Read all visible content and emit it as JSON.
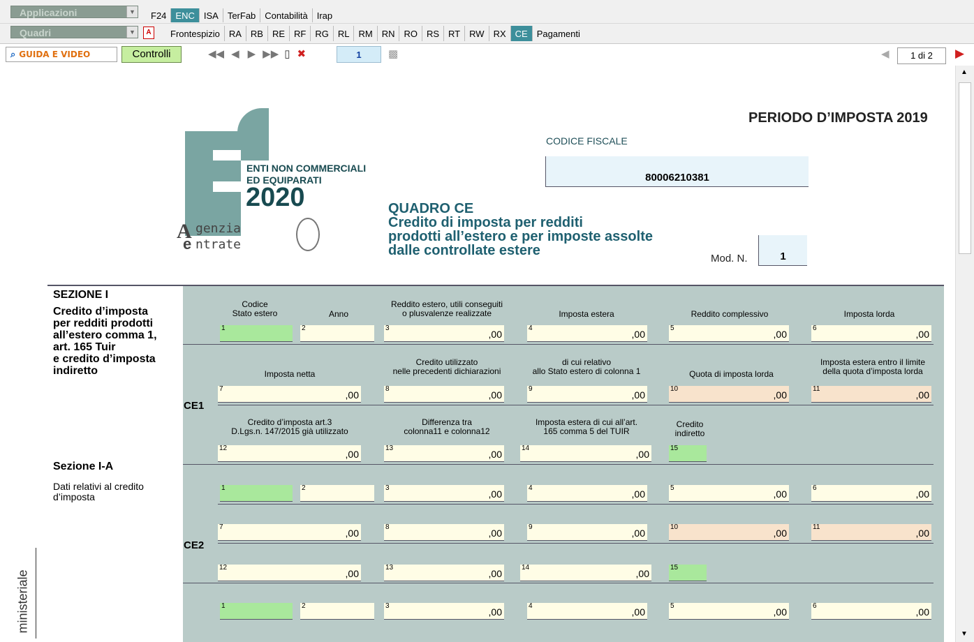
{
  "toolbar1": {
    "combo": "Applicazioni",
    "tabs": [
      "F24",
      "ENC",
      "ISA",
      "TerFab",
      "Contabilità",
      "Irap"
    ],
    "active": "ENC"
  },
  "toolbar2": {
    "combo": "Quadri",
    "tabs": [
      "Frontespizio",
      "RA",
      "RB",
      "RE",
      "RF",
      "RG",
      "RL",
      "RM",
      "RN",
      "RO",
      "RS",
      "RT",
      "RW",
      "RX",
      "CE",
      "Pagamenti"
    ],
    "active": "CE"
  },
  "toolbar3": {
    "guide": "GUIDA E VIDEO",
    "controlli": "Controlli",
    "page": "1",
    "pageinfo": "1 di 2"
  },
  "header": {
    "periodo": "PERIODO D’IMPOSTA 2019",
    "cf_label": "CODICE FISCALE",
    "cf_value": "80006210381",
    "logo_l1": "ENTI NON COMMERCIALI",
    "logo_l2": "ED EQUIPARATI",
    "logo_year": "2020",
    "agenzia_1": "genzia",
    "agenzia_2": "ntrate",
    "quadro": "QUADRO CE",
    "titolo_1": "Credito di imposta per redditi",
    "titolo_2": "prodotti all’estero e per imposte assolte",
    "titolo_3": "dalle controllate estere",
    "mod_label": "Mod. N.",
    "mod_value": "1"
  },
  "left": {
    "sez": "SEZIONE I",
    "desc_1": "Credito d’imposta",
    "desc_2": "per redditi prodotti",
    "desc_3": "all’estero comma 1,",
    "desc_4": "art. 165 Tuir",
    "desc_5": "e credito d’imposta",
    "desc_6": "indiretto",
    "sezA": "Sezione I-A",
    "sezA_d1": "Dati relativi al credito",
    "sezA_d2": "d’imposta",
    "side": "ministeriale"
  },
  "rows": {
    "ce1": "CE1",
    "ce2": "CE2"
  },
  "cols": {
    "c1a": "Codice",
    "c1b": "Stato estero",
    "c2": "Anno",
    "c3a": "Reddito estero, utili conseguiti",
    "c3b": "o plusvalenze realizzate",
    "c4": "Imposta estera",
    "c5": "Reddito complessivo",
    "c6": "Imposta lorda",
    "c7": "Imposta netta",
    "c8a": "Credito utilizzato",
    "c8b": "nelle precedenti dichiarazioni",
    "c9a": "di cui relativo",
    "c9b": "allo Stato estero di colonna 1",
    "c10": "Quota di imposta lorda",
    "c11a": "Imposta estera entro il limite",
    "c11b": "della quota d’imposta lorda",
    "c12a": "Credito d’imposta art.3",
    "c12b": "D.Lgs.n. 147/2015 già utilizzato",
    "c13a": "Differenza tra",
    "c13b": "colonna11 e colonna12",
    "c14a": "Imposta estera di cui all’art.",
    "c14b": "165 comma 5 del TUIR",
    "c15a": "Credito",
    "c15b": "indiretto"
  },
  "fields": {
    "zero": ",00",
    "n1": "1",
    "n2": "2",
    "n3": "3",
    "n4": "4",
    "n5": "5",
    "n6": "6",
    "n7": "7",
    "n8": "8",
    "n9": "9",
    "n10": "10",
    "n11": "11",
    "n12": "12",
    "n13": "13",
    "n14": "14",
    "n15": "15"
  }
}
